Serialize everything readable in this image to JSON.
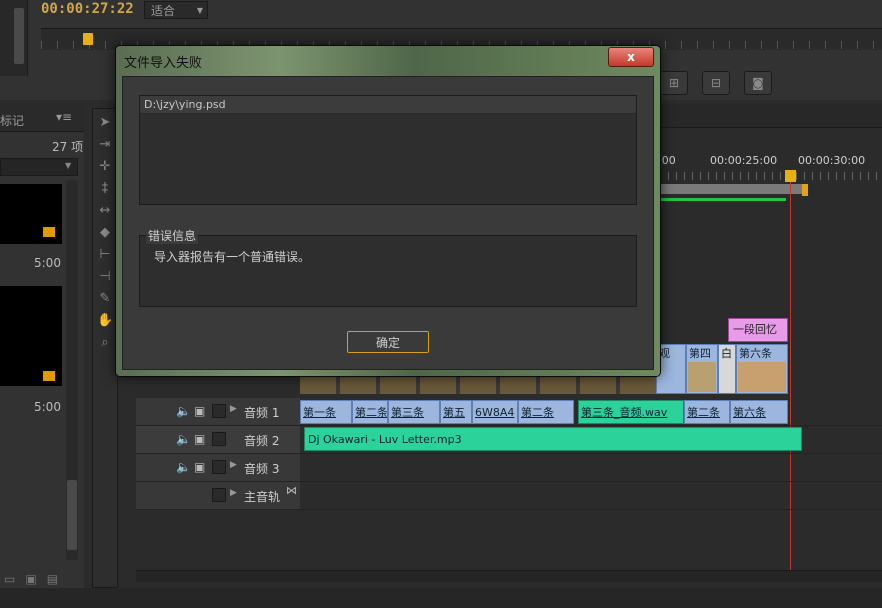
{
  "monitor": {
    "timecode": "00:00:27:22",
    "fit_label": "适合"
  },
  "project": {
    "tab_label": "标记",
    "item_count": "27 项",
    "thumbs": [
      {
        "duration": "5:00"
      },
      {
        "duration": "5:00"
      }
    ]
  },
  "timeline": {
    "ruler_labels": [
      ":00",
      "00:00:25:00",
      "00:00:30:00"
    ],
    "audio_tracks": [
      {
        "name": "音频 1"
      },
      {
        "name": "音频 2"
      },
      {
        "name": "音频 3"
      },
      {
        "name": "主音轨"
      }
    ],
    "title_clip": "一段回忆",
    "video_clips": [
      "观",
      "第四",
      "白",
      "第六条"
    ],
    "audio1_clips": [
      "第一条",
      "第二条",
      "第三条",
      "第五",
      "6W8A4",
      "第二条",
      "第三条_音频.wav",
      "第二条",
      "第六条"
    ],
    "audio2_clip": "Dj Okawari - Luv Letter.mp3"
  },
  "dialog": {
    "title": "文件导入失败",
    "close_label": "x",
    "file_path": "D:\\jzy\\ying.psd",
    "group_label": "错误信息",
    "message": "导入器报告有一个普通错误。",
    "ok_label": "确定"
  }
}
